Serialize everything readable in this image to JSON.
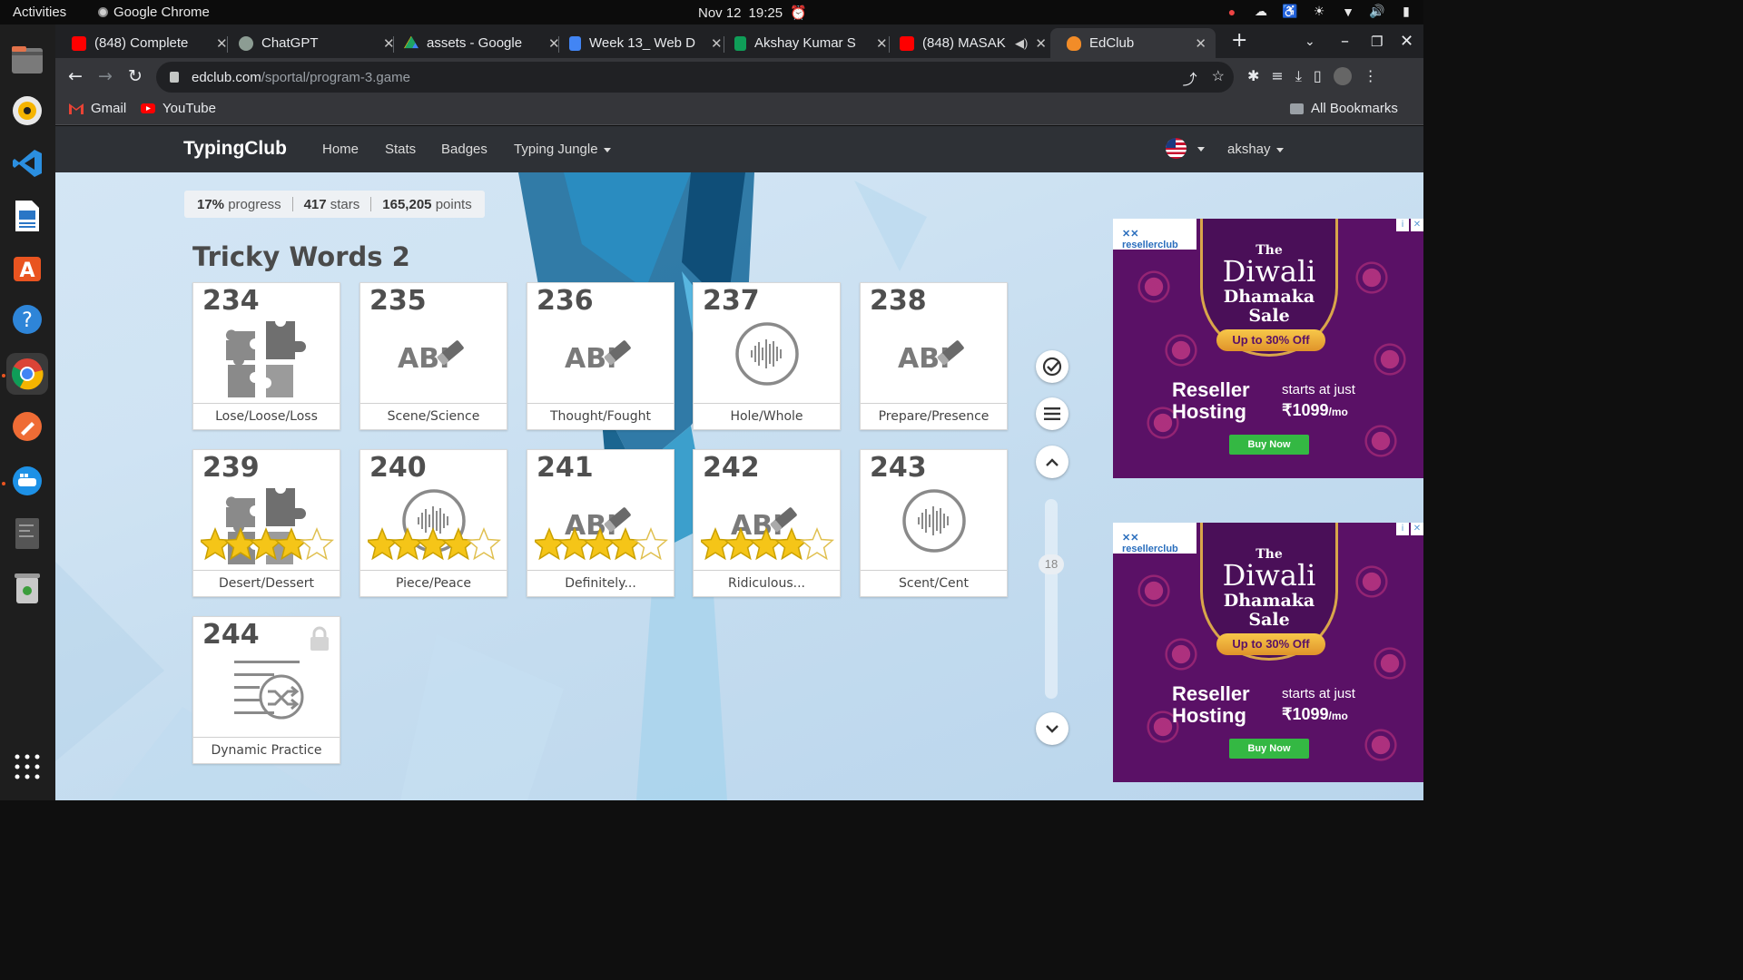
{
  "os": {
    "activities": "Activities",
    "app_name": "Google Chrome",
    "date": "Nov 12",
    "time": "19:25"
  },
  "browser": {
    "tabs": [
      {
        "title": "(848) Complete",
        "favicon": "youtube-icon",
        "color": "#ff0000"
      },
      {
        "title": "ChatGPT",
        "favicon": "chatgpt-icon",
        "color": "#8c9c93"
      },
      {
        "title": "assets - Google",
        "favicon": "google-drive-icon",
        "color": "#1fa463"
      },
      {
        "title": "Week 13_ Web D",
        "favicon": "google-docs-icon",
        "color": "#4285f4"
      },
      {
        "title": "Akshay Kumar S",
        "favicon": "google-sheets-icon",
        "color": "#0f9d58"
      },
      {
        "title": "(848) MASAK",
        "favicon": "youtube-icon",
        "color": "#ff0000"
      },
      {
        "title": "EdClub",
        "favicon": "edclub-icon",
        "color": "#f28c28"
      }
    ],
    "url_host": "edclub.com",
    "url_path": "/sportal/program-3.game",
    "bookmarks": [
      "Gmail",
      "YouTube"
    ],
    "all_bookmarks": "All Bookmarks"
  },
  "site": {
    "logo": "TypingClub",
    "nav": [
      "Home",
      "Stats",
      "Badges",
      "Typing Jungle"
    ],
    "user": "akshay",
    "progress": {
      "pct_value": "17%",
      "pct_label": "progress",
      "stars_value": "417",
      "stars_label": "stars",
      "points_value": "165,205",
      "points_label": "points"
    },
    "section_title": "Tricky Words 2",
    "scroll_index": "18"
  },
  "lessons": [
    {
      "num": "234",
      "label": "Lose/Loose/Loss",
      "icon": "puzzle-icon",
      "stars": 0
    },
    {
      "num": "235",
      "label": "Scene/Science",
      "icon": "abc-eraser-icon",
      "stars": 0
    },
    {
      "num": "236",
      "label": "Thought/Fought",
      "icon": "abc-eraser-icon",
      "stars": 0
    },
    {
      "num": "237",
      "label": "Hole/Whole",
      "icon": "audio-wave-icon",
      "stars": 0
    },
    {
      "num": "238",
      "label": "Prepare/Presence",
      "icon": "abc-eraser-icon",
      "stars": 0
    },
    {
      "num": "239",
      "label": "Desert/Dessert",
      "icon": "puzzle-icon",
      "stars": 4
    },
    {
      "num": "240",
      "label": "Piece/Peace",
      "icon": "audio-wave-icon",
      "stars": 4
    },
    {
      "num": "241",
      "label": "Definitely...",
      "icon": "abc-eraser-icon",
      "stars": 4
    },
    {
      "num": "242",
      "label": "Ridiculous...",
      "icon": "abc-eraser-icon",
      "stars": 4
    },
    {
      "num": "243",
      "label": "Scent/Cent",
      "icon": "audio-wave-icon",
      "stars": 0
    },
    {
      "num": "244",
      "label": "Dynamic Practice",
      "icon": "shuffle-list-icon",
      "stars": 0,
      "locked": true
    }
  ],
  "ads": [
    {
      "brand": "resellerclub",
      "the": "The",
      "title": "Diwali",
      "subtitle": "Dhamaka Sale",
      "offer": "Up to 30% Off",
      "product": "Reseller Hosting",
      "starts": "starts at just",
      "price": "₹1099",
      "per": "/mo",
      "cta": "Buy Now"
    },
    {
      "brand": "resellerclub",
      "the": "The",
      "title": "Diwali",
      "subtitle": "Dhamaka Sale",
      "offer": "Up to 30% Off",
      "product": "Reseller Hosting",
      "starts": "starts at just",
      "price": "₹1099",
      "per": "/mo",
      "cta": "Buy Now"
    }
  ],
  "colors": {
    "accent": "#2e3136",
    "star": "#f5c518",
    "ad_bg": "#5a1166"
  }
}
